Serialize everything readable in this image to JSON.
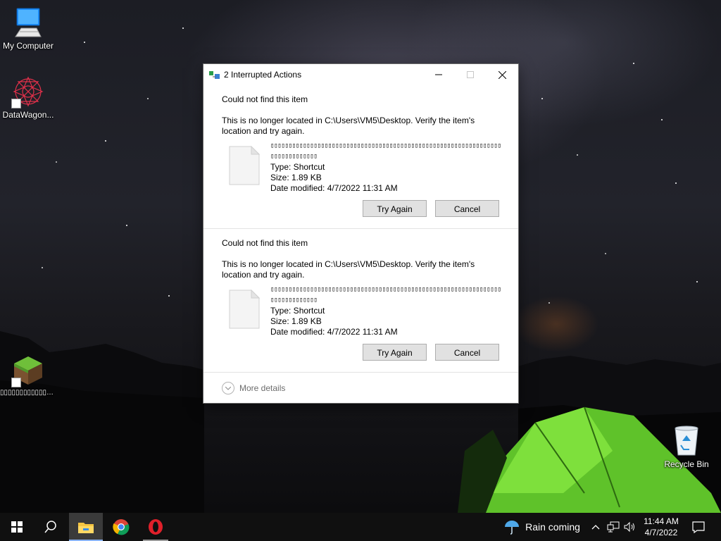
{
  "desktop": {
    "icons": [
      {
        "label": "My Computer",
        "icon": "computer-icon"
      },
      {
        "label": "DataWagon...",
        "icon": "datawagon-icon"
      },
      {
        "label": "▯▯▯▯▯▯▯▯▯▯▯▯▯▯...",
        "icon": "minecraft-icon"
      },
      {
        "label": "Recycle Bin",
        "icon": "recycle-bin-icon"
      }
    ]
  },
  "dialog": {
    "title": "2 Interrupted Actions",
    "items": [
      {
        "heading": "Could not find this item",
        "message": "This is no longer located in C:\\Users\\VM5\\Desktop. Verify the item's location and try again.",
        "file_name": "▯▯▯▯▯▯▯▯▯▯▯▯▯▯▯▯▯▯▯▯▯▯▯▯▯▯▯▯▯▯▯▯▯▯▯▯▯▯▯▯▯▯▯▯▯▯▯▯▯▯▯▯▯▯▯▯▯▯▯▯▯▯▯▯▯▯▯▯▯▯▯▯▯▯▯▯▯",
        "type": "Type: Shortcut",
        "size": "Size: 1.89 KB",
        "date_modified": "Date modified: 4/7/2022 11:31 AM",
        "try_again_label": "Try Again",
        "cancel_label": "Cancel"
      },
      {
        "heading": "Could not find this item",
        "message": "This is no longer located in C:\\Users\\VM5\\Desktop. Verify the item's location and try again.",
        "file_name": "▯▯▯▯▯▯▯▯▯▯▯▯▯▯▯▯▯▯▯▯▯▯▯▯▯▯▯▯▯▯▯▯▯▯▯▯▯▯▯▯▯▯▯▯▯▯▯▯▯▯▯▯▯▯▯▯▯▯▯▯▯▯▯▯▯▯▯▯▯▯▯▯▯▯▯▯▯",
        "type": "Type: Shortcut",
        "size": "Size: 1.89 KB",
        "date_modified": "Date modified: 4/7/2022 11:31 AM",
        "try_again_label": "Try Again",
        "cancel_label": "Cancel"
      }
    ],
    "more_details_label": "More details"
  },
  "taskbar": {
    "weather_text": "Rain coming",
    "time": "11:44 AM",
    "date": "4/7/2022",
    "pinned": [
      "start-icon",
      "search-icon",
      "file-explorer-icon",
      "chrome-icon",
      "opera-icon"
    ]
  }
}
